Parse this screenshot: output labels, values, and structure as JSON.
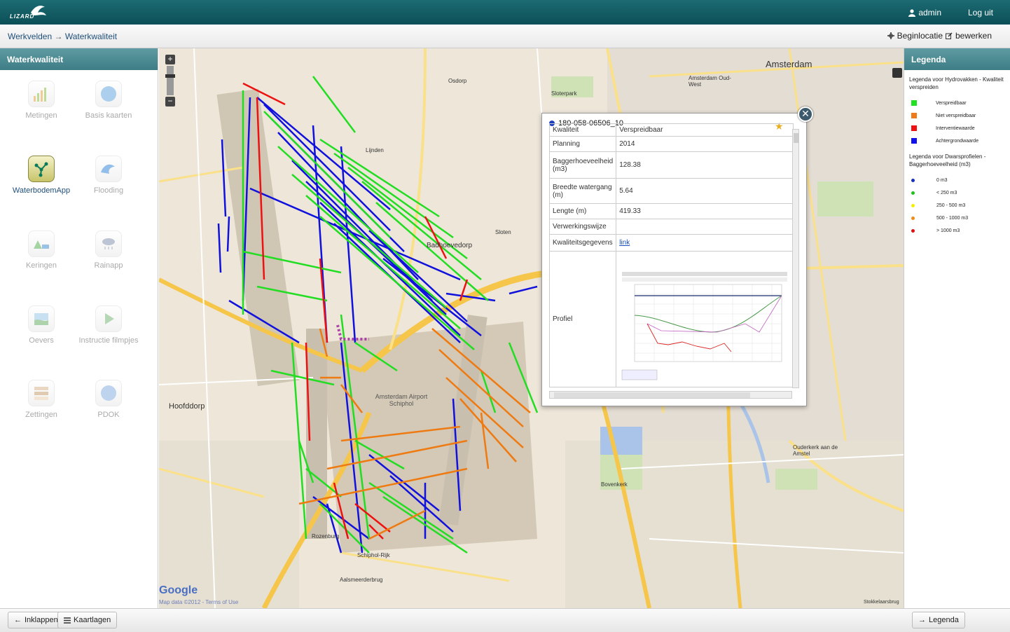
{
  "app": {
    "logo": "LIZARD",
    "user": "admin",
    "logout": "Log uit"
  },
  "breadcrumb": {
    "part1": "Werkvelden",
    "sep": "→",
    "part2": "Waterkwaliteit"
  },
  "actions": {
    "begin": "Beginlocatie",
    "edit": "bewerken"
  },
  "left_panel": {
    "title": "Waterkwaliteit",
    "apps": [
      {
        "label": "Metingen",
        "icon": "chart-icon"
      },
      {
        "label": "Basis kaarten",
        "icon": "globe-icon"
      },
      {
        "label": "WaterbodemApp",
        "icon": "network-icon"
      },
      {
        "label": "Flooding",
        "icon": "wave-icon"
      },
      {
        "label": "Keringen",
        "icon": "dike-icon"
      },
      {
        "label": "Rainapp",
        "icon": "rain-cloud-icon"
      },
      {
        "label": "Oevers",
        "icon": "bank-icon"
      },
      {
        "label": "Instructie filmpjes",
        "icon": "play-icon"
      },
      {
        "label": "Zettingen",
        "icon": "layers-icon"
      },
      {
        "label": "PDOK",
        "icon": "wms-icon"
      }
    ]
  },
  "map": {
    "labels": {
      "amsterdam": "Amsterdam",
      "badhoevedorp": "Badhoevedorp",
      "hoofddorp": "Hoofddorp",
      "schiphol": "Amsterdam Airport Schiphol",
      "osdorp": "Osdorp",
      "sloterpark": "Sloterpark",
      "rozenburg": "Rozenburg",
      "aalsmeerderbrug": "Aalsmeerderbrug",
      "ouderkerk": "Ouderkerk aan de Amstel",
      "bovenkerk": "Bovenkerk",
      "amsterdam_oud_west": "Amsterdam Oud-West",
      "stokkelaarsbrug": "Stokkelaarsbrug",
      "sloten": "Sloten",
      "lijnden": "Lijnden",
      "schiphol_rijk": "Schiphol-Rijk"
    },
    "attribution": {
      "google": "Google",
      "data": "Map data ©2012 - Terms of Use"
    }
  },
  "popup": {
    "id": "180-058-06506_10",
    "rows": [
      {
        "key": "Kwaliteit",
        "value": "Verspreidbaar"
      },
      {
        "key": "Planning",
        "value": "2014"
      },
      {
        "key": "Baggerhoeveelheid (m3)",
        "value": "128.38"
      },
      {
        "key": "Breedte watergang (m)",
        "value": "5.64"
      },
      {
        "key": "Lengte (m)",
        "value": "419.33"
      },
      {
        "key": "Verwerkingswijze",
        "value": ""
      },
      {
        "key": "Kwaliteitsgegevens",
        "value": "link"
      },
      {
        "key": "Profiel",
        "value": ""
      }
    ]
  },
  "legend": {
    "title": "Legenda",
    "hydro_title": "Legenda voor Hydrovakken - Kwaliteit verspreiden",
    "hydro_items": [
      {
        "label": "Verspreidbaar",
        "color": "#22e022"
      },
      {
        "label": "Niet verspreidbaar",
        "color": "#f07a1a"
      },
      {
        "label": "Interventiewaarde",
        "color": "#ee1111"
      },
      {
        "label": "Achtergrondwaarde",
        "color": "#1111ee"
      }
    ],
    "profile_title": "Legenda voor Dwarsprofielen - Baggerhoeveelheid (m3)",
    "profile_items": [
      {
        "label": "0 m3",
        "color": "#1a2fc0"
      },
      {
        "label": "< 250 m3",
        "color": "#22c022"
      },
      {
        "label": "250 - 500 m3",
        "color": "#f2f000"
      },
      {
        "label": "500 - 1000 m3",
        "color": "#f08a1a"
      },
      {
        "label": "> 1000 m3",
        "color": "#dd1111"
      }
    ]
  },
  "bottom": {
    "collapse": "Inklappen",
    "layers": "Kaartlagen",
    "legend": "Legenda"
  }
}
